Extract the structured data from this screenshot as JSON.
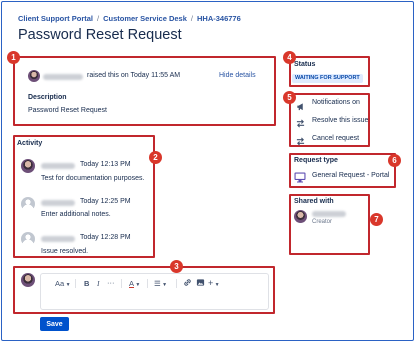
{
  "breadcrumb": {
    "items": [
      "Client Support Portal",
      "Customer Service Desk",
      "HHA-346776"
    ],
    "separator": "/"
  },
  "page_title": "Password Reset Request",
  "badges": [
    "1",
    "2",
    "3",
    "4",
    "5",
    "6",
    "7"
  ],
  "header": {
    "raised_text": "raised this on Today 11:55 AM",
    "hide_details": "Hide details"
  },
  "description": {
    "label": "Description",
    "value": "Password Reset Request"
  },
  "activity": {
    "label": "Activity",
    "items": [
      {
        "time": "Today 12:13 PM",
        "text": "Test for documentation purposes.",
        "avatar": "user-photo"
      },
      {
        "time": "Today 12:25 PM",
        "text": "Enter additional notes.",
        "avatar": "default-avatar"
      },
      {
        "time": "Today 12:28 PM",
        "text": "Issue resolved.",
        "avatar": "default-avatar"
      }
    ]
  },
  "editor": {
    "toolbar": {
      "text_style": "Aa",
      "bold": "B",
      "italic": "I",
      "more": "···",
      "text_color": "A",
      "list": "☰",
      "link": "🔗",
      "image": "▣",
      "insert": "+"
    },
    "save_label": "Save"
  },
  "status": {
    "label": "Status",
    "value": "WAITING FOR SUPPORT",
    "color": "#deebff"
  },
  "actions": [
    {
      "label": "Notifications on",
      "icon": "megaphone-icon"
    },
    {
      "label": "Resolve this issue",
      "icon": "transition-arrows-icon"
    },
    {
      "label": "Cancel request",
      "icon": "transition-arrows-icon"
    }
  ],
  "request_type": {
    "label": "Request type",
    "value": "General Request - Portal",
    "icon": "monitor-icon"
  },
  "shared_with": {
    "label": "Shared with",
    "role": "Creator"
  },
  "colors": {
    "accent": "#0052cc",
    "link": "#2954a3",
    "callout": "#c1272d",
    "badge": "#d9372b"
  }
}
